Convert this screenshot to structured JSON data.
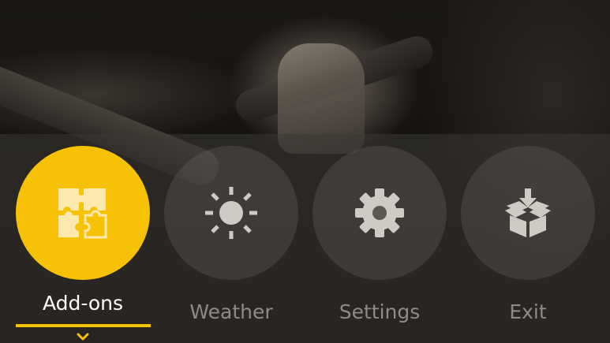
{
  "menu": {
    "items": [
      {
        "label": "Add-ons",
        "icon": "puzzle-icon",
        "active": true
      },
      {
        "label": "Weather",
        "icon": "sun-icon",
        "active": false
      },
      {
        "label": "Settings",
        "icon": "gear-icon",
        "active": false
      },
      {
        "label": "Exit",
        "icon": "box-download-icon",
        "active": false
      }
    ]
  },
  "colors": {
    "accent": "#f7c105",
    "inactive_icon": "#cfcac4",
    "inactive_label": "#8f8a84",
    "active_label": "#ffffff"
  }
}
